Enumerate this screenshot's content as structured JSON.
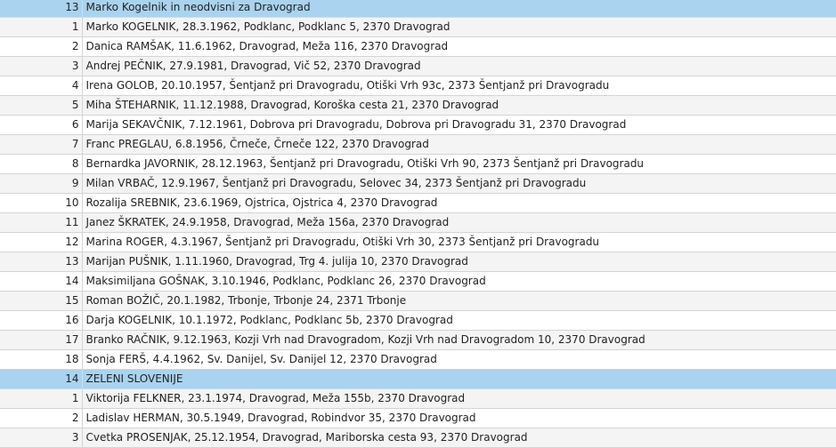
{
  "groups": [
    {
      "number": "13",
      "name": "Marko Kogelnik in neodvisni za Dravograd",
      "candidates": [
        {
          "n": "1",
          "text": "Marko KOGELNIK, 28.3.1962, Podklanc, Podklanc 5, 2370 Dravograd"
        },
        {
          "n": "2",
          "text": "Danica RAMŠAK, 11.6.1962, Dravograd, Meža 116, 2370 Dravograd"
        },
        {
          "n": "3",
          "text": "Andrej PEČNIK, 27.9.1981, Dravograd, Vič 52, 2370 Dravograd"
        },
        {
          "n": "4",
          "text": "Irena GOLOB, 20.10.1957, Šentjanž pri Dravogradu, Otiški Vrh 93c, 2373 Šentjanž pri Dravogradu"
        },
        {
          "n": "5",
          "text": "Miha ŠTEHARNIK, 11.12.1988, Dravograd, Koroška cesta 21, 2370 Dravograd"
        },
        {
          "n": "6",
          "text": "Marija SEKAVČNIK, 7.12.1961, Dobrova pri Dravogradu, Dobrova pri Dravogradu 31, 2370 Dravograd"
        },
        {
          "n": "7",
          "text": "Franc PREGLAU, 6.8.1956, Črneče, Črneče 122, 2370 Dravograd"
        },
        {
          "n": "8",
          "text": "Bernardka JAVORNIK, 28.12.1963, Šentjanž pri Dravogradu, Otiški Vrh 90, 2373 Šentjanž pri Dravogradu"
        },
        {
          "n": "9",
          "text": "Milan VRBAČ, 12.9.1967, Šentjanž pri Dravogradu, Selovec 34, 2373 Šentjanž pri Dravogradu"
        },
        {
          "n": "10",
          "text": "Rozalija SREBNIK, 23.6.1969, Ojstrica, Ojstrica 4, 2370 Dravograd"
        },
        {
          "n": "11",
          "text": "Janez ŠKRATEK, 24.9.1958, Dravograd, Meža 156a, 2370 Dravograd"
        },
        {
          "n": "12",
          "text": "Marina ROGER, 4.3.1967, Šentjanž pri Dravogradu, Otiški Vrh 30, 2373 Šentjanž pri Dravogradu"
        },
        {
          "n": "13",
          "text": "Marijan PUŠNIK, 1.11.1960, Dravograd, Trg 4. julija 10, 2370 Dravograd"
        },
        {
          "n": "14",
          "text": "Maksimiljana GOŠNAK, 3.10.1946, Podklanc, Podklanc 26, 2370 Dravograd"
        },
        {
          "n": "15",
          "text": "Roman BOŽIČ, 20.1.1982, Trbonje, Trbonje 24, 2371 Trbonje"
        },
        {
          "n": "16",
          "text": "Darja KOGELNIK, 10.1.1972, Podklanc, Podklanc 5b, 2370 Dravograd"
        },
        {
          "n": "17",
          "text": "Branko RAČNIK, 9.12.1963, Kozji Vrh nad Dravogradom, Kozji Vrh nad Dravogradom 10, 2370 Dravograd"
        },
        {
          "n": "18",
          "text": "Sonja FERŠ, 4.4.1962, Sv. Danijel, Sv. Danijel 12, 2370 Dravograd"
        }
      ]
    },
    {
      "number": "14",
      "name": "ZELENI SLOVENIJE",
      "candidates": [
        {
          "n": "1",
          "text": "Viktorija FELKNER, 23.1.1974, Dravograd, Meža 155b, 2370 Dravograd"
        },
        {
          "n": "2",
          "text": "Ladislav HERMAN, 30.5.1949, Dravograd, Robindvor 35, 2370 Dravograd"
        },
        {
          "n": "3",
          "text": "Cvetka PROSENJAK, 25.12.1954, Dravograd, Mariborska cesta 93, 2370 Dravograd"
        }
      ]
    }
  ]
}
